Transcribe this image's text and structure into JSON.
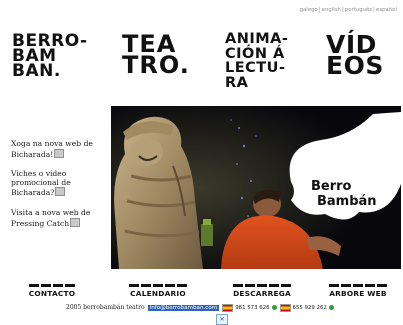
{
  "languages": [
    "galego",
    "english",
    "português",
    "español"
  ],
  "sections": {
    "berro": "BERRO-\nBAM\nBAN.",
    "teatro": "TEA\nTRO.",
    "animacion": "ANIMA-\nCIÓN Á\nLECTU-\nRA",
    "videos": "VÍD\nEOS"
  },
  "news": [
    {
      "text": "Xoga na nova web de Bicharada!"
    },
    {
      "text": "Viches o vídeo promocional de Bicharada?"
    },
    {
      "text": "Visita a nova web de Pressing Catch"
    }
  ],
  "logo_text": {
    "line1": "Berro",
    "line2": "Bambán"
  },
  "nav": {
    "contacto": "CONTACTO",
    "calendario": "CALENDARIO",
    "descarrega": "DESCARREGA",
    "arbore": "ARBORE WEB"
  },
  "footer": {
    "copyright": "2005 berrobambán teatro",
    "email": "info@berrobamban.com",
    "phone1": "981 573 626",
    "phone2": "655 929 262"
  },
  "badge": "✕"
}
